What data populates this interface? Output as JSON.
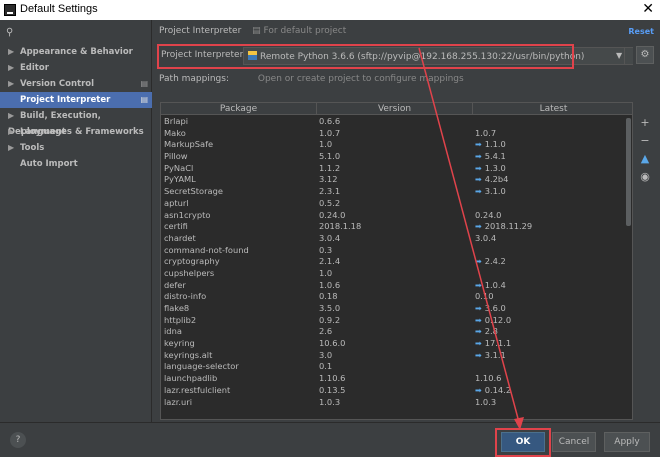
{
  "window": {
    "title": "Default Settings",
    "close_glyph": "✕"
  },
  "sidebar": {
    "search_icon": "⚲",
    "items": [
      {
        "label": "Appearance & Behavior",
        "arrow": "▶"
      },
      {
        "label": "Editor",
        "arrow": "▶"
      },
      {
        "label": "Version Control",
        "arrow": "▶"
      },
      {
        "label": "Project Interpreter",
        "arrow": ""
      },
      {
        "label": "Build, Execution, Deployment",
        "arrow": "▶"
      },
      {
        "label": "Languages & Frameworks",
        "arrow": "▶"
      },
      {
        "label": "Tools",
        "arrow": "▶"
      },
      {
        "label": "Auto Import",
        "arrow": ""
      }
    ]
  },
  "header": {
    "title": "Project Interpreter",
    "subtitle": "For default project",
    "reset": "Reset"
  },
  "interpreter": {
    "label": "Project Interpreter:",
    "value": "Remote Python 3.6.6 (sftp://pyvip@192.168.255.130:22/usr/bin/python)",
    "dropdown_glyph": "▼",
    "gear_glyph": "⚙"
  },
  "path_mappings": {
    "label": "Path mappings:",
    "value": "Open or create project to configure mappings"
  },
  "table": {
    "columns": [
      "Package",
      "Version",
      "Latest"
    ],
    "rows": [
      [
        "Brlapi",
        "0.6.6",
        ""
      ],
      [
        "Mako",
        "1.0.7",
        "1.0.7"
      ],
      [
        "MarkupSafe",
        "1.0",
        "1.1.0"
      ],
      [
        "Pillow",
        "5.1.0",
        "5.4.1"
      ],
      [
        "PyNaCl",
        "1.1.2",
        "1.3.0"
      ],
      [
        "PyYAML",
        "3.12",
        "4.2b4"
      ],
      [
        "SecretStorage",
        "2.3.1",
        "3.1.0"
      ],
      [
        "apturl",
        "0.5.2",
        ""
      ],
      [
        "asn1crypto",
        "0.24.0",
        "0.24.0"
      ],
      [
        "certifi",
        "2018.1.18",
        "2018.11.29"
      ],
      [
        "chardet",
        "3.0.4",
        "3.0.4"
      ],
      [
        "command-not-found",
        "0.3",
        ""
      ],
      [
        "cryptography",
        "2.1.4",
        "2.4.2"
      ],
      [
        "cupshelpers",
        "1.0",
        ""
      ],
      [
        "defer",
        "1.0.6",
        "1.0.4"
      ],
      [
        "distro-info",
        "0.18",
        "0.10"
      ],
      [
        "flake8",
        "3.5.0",
        "3.6.0"
      ],
      [
        "httplib2",
        "0.9.2",
        "0.12.0"
      ],
      [
        "idna",
        "2.6",
        "2.8"
      ],
      [
        "keyring",
        "10.6.0",
        "17.1.1"
      ],
      [
        "keyrings.alt",
        "3.0",
        "3.1.1"
      ],
      [
        "language-selector",
        "0.1",
        ""
      ],
      [
        "launchpadlib",
        "1.10.6",
        "1.10.6"
      ],
      [
        "lazr.restfulclient",
        "0.13.5",
        "0.14.2"
      ],
      [
        "lazr.uri",
        "1.0.3",
        "1.0.3"
      ]
    ],
    "upgrade_rows": [
      2,
      3,
      4,
      5,
      6,
      9,
      12,
      14,
      16,
      17,
      18,
      19,
      20,
      23
    ],
    "upgrade_glyph": "➡"
  },
  "tools": {
    "add": "+",
    "remove": "−",
    "upgrade": "▲",
    "eye": "◉"
  },
  "footer": {
    "help": "?",
    "ok": "OK",
    "cancel": "Cancel",
    "apply": "Apply"
  },
  "colors": {
    "accent": "#4b6eaf",
    "highlight": "#e0434b",
    "upgrade_arrow": "#5aa7e8",
    "ok_button": "#365880"
  }
}
